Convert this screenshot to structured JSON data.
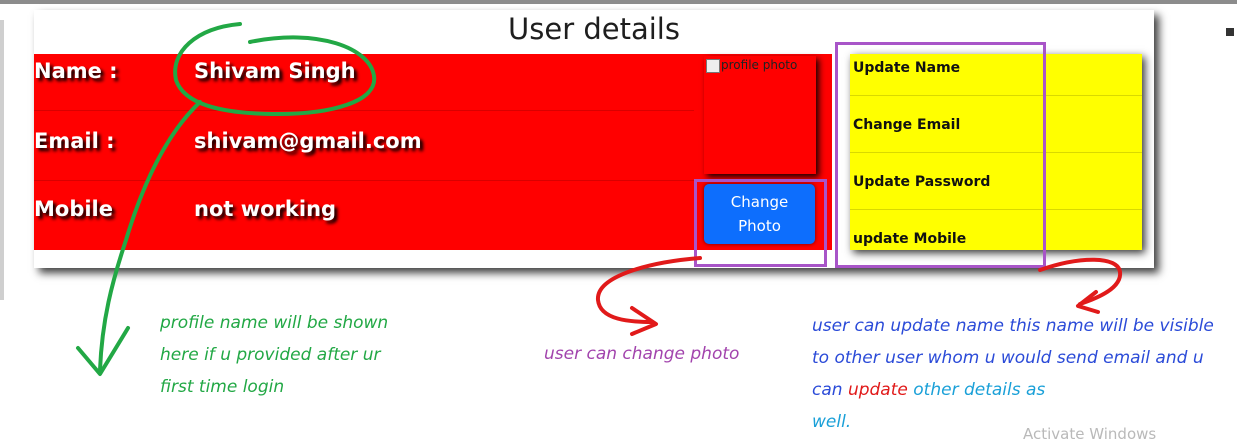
{
  "card": {
    "title": "User details"
  },
  "details": [
    {
      "label": "Name :",
      "value": "Shivam Singh"
    },
    {
      "label": "Email :",
      "value": "shivam@gmail.com"
    },
    {
      "label": "Mobile",
      "value": "not working"
    }
  ],
  "photo": {
    "alt_text": "profile photo",
    "change_button_line1": "Change",
    "change_button_line2": "Photo"
  },
  "actions": [
    {
      "label": "Update Name"
    },
    {
      "label": "Change Email"
    },
    {
      "label": "Update Password"
    },
    {
      "label": "update Mobile"
    }
  ],
  "annotations": {
    "green_note_line1": "profile name will be shown",
    "green_note_line2": "here if u provided after ur",
    "green_note_line3": "first time login",
    "purple_note": "user can change photo",
    "blue_note_part1": "user can update name this name will be visible to other user whom u would send email and u can ",
    "blue_note_red_word": "update",
    "blue_note_cyan_part": " other details as",
    "blue_note_last": "well."
  },
  "watermark": "Activate Windows",
  "colors": {
    "details_bg": "#ff0000",
    "actions_bg": "#ffff00",
    "button_bg": "#0d6efd",
    "annotation_box": "#a855c8",
    "annotation_green": "#22a845",
    "annotation_red": "#e11a1a",
    "annotation_blue": "#2b4bd8"
  }
}
